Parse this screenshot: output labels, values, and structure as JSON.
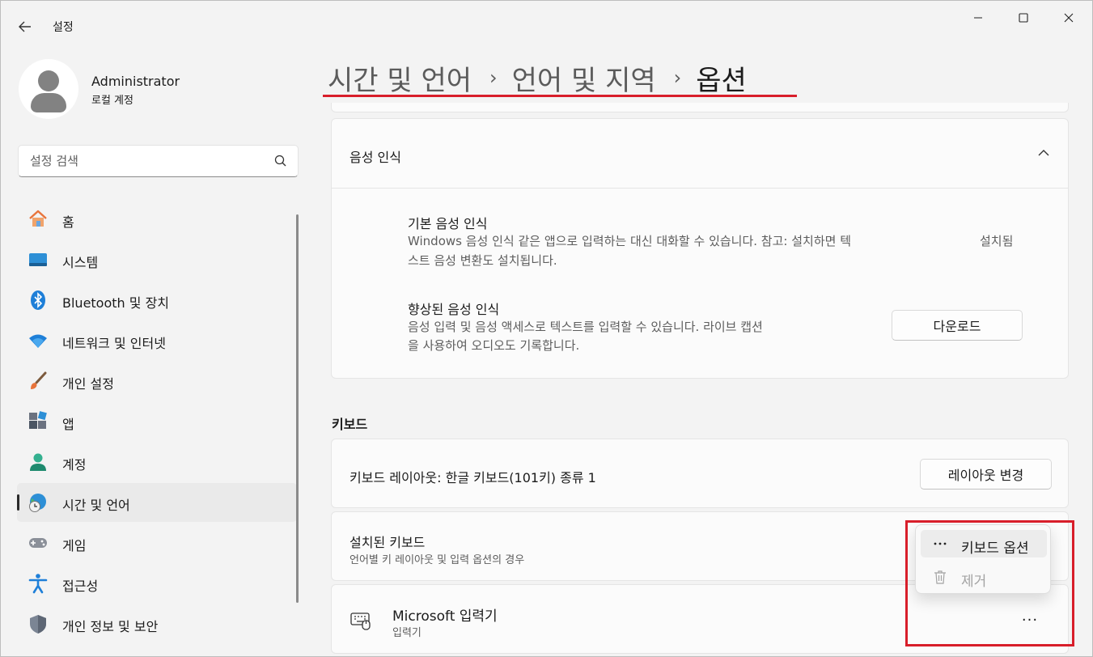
{
  "window": {
    "title": "설정",
    "controls": {
      "minimize": "minimize-icon",
      "maximize": "maximize-icon",
      "close": "close-icon"
    }
  },
  "profile": {
    "name": "Administrator",
    "account_type": "로컬 계정"
  },
  "search": {
    "placeholder": "설정 검색"
  },
  "sidebar": {
    "items": [
      {
        "label": "홈",
        "icon": "home-icon"
      },
      {
        "label": "시스템",
        "icon": "system-icon"
      },
      {
        "label": "Bluetooth 및 장치",
        "icon": "bluetooth-icon"
      },
      {
        "label": "네트워크 및 인터넷",
        "icon": "wifi-icon"
      },
      {
        "label": "개인 설정",
        "icon": "brush-icon"
      },
      {
        "label": "앱",
        "icon": "apps-icon"
      },
      {
        "label": "계정",
        "icon": "account-icon"
      },
      {
        "label": "시간 및 언어",
        "icon": "time-language-icon",
        "selected": true
      },
      {
        "label": "게임",
        "icon": "gaming-icon"
      },
      {
        "label": "접근성",
        "icon": "accessibility-icon"
      },
      {
        "label": "개인 정보 및 보안",
        "icon": "shield-icon"
      }
    ]
  },
  "breadcrumb": {
    "items": [
      "시간 및 언어",
      "언어 및 지역",
      "옵션"
    ],
    "separator": "›"
  },
  "speech": {
    "title": "음성 인식",
    "basic": {
      "title": "기본 음성 인식",
      "desc_line1": "Windows 음성 인식 같은 앱으로 입력하는 대신 대화할 수 있습니다. 참고: 설치하면 텍",
      "desc_line2": "스트 음성 변환도 설치됩니다.",
      "status": "설치됨"
    },
    "enhanced": {
      "title": "향상된 음성 인식",
      "desc_line1": "음성 입력 및 음성 액세스로 텍스트를 입력할 수 있습니다. 라이브 캡션",
      "desc_line2": "을 사용하여 오디오도 기록합니다.",
      "button": "다운로드"
    }
  },
  "keyboard": {
    "section_title": "키보드",
    "layout_text": "키보드 레이아웃: 한글 키보드(101키) 종류 1",
    "layout_button": "레이아웃 변경",
    "installed_title": "설치된 키보드",
    "installed_sub": "언어별 키 레이아웃 및 입력 옵션의 경우",
    "ime_title": "Microsoft 입력기",
    "ime_sub": "입력기",
    "more": "···"
  },
  "context_menu": {
    "items": [
      {
        "label": "키보드 옵션",
        "icon": "more-icon",
        "enabled": true
      },
      {
        "label": "제거",
        "icon": "trash-icon",
        "enabled": false
      }
    ]
  },
  "colors": {
    "annotation": "#d81e2a",
    "accent": "#0067c0"
  }
}
